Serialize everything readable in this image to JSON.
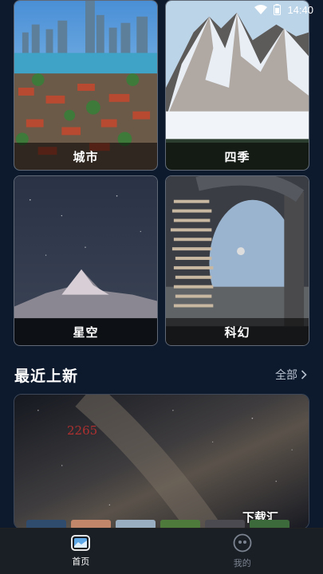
{
  "status": {
    "time": "14:40"
  },
  "categories": [
    {
      "label": "城市"
    },
    {
      "label": "四季"
    },
    {
      "label": "星空"
    },
    {
      "label": "科幻"
    }
  ],
  "recent": {
    "title": "最近上新",
    "see_all": "全部"
  },
  "banner": {
    "number": "2265",
    "watermark": "下载汇"
  },
  "tabs": [
    {
      "label": "首页",
      "icon": "image-icon",
      "active": true
    },
    {
      "label": "我的",
      "icon": "profile-icon",
      "active": false
    }
  ],
  "colors": {
    "background": "#0d1a2e",
    "tabbar": "#1a1f26"
  }
}
